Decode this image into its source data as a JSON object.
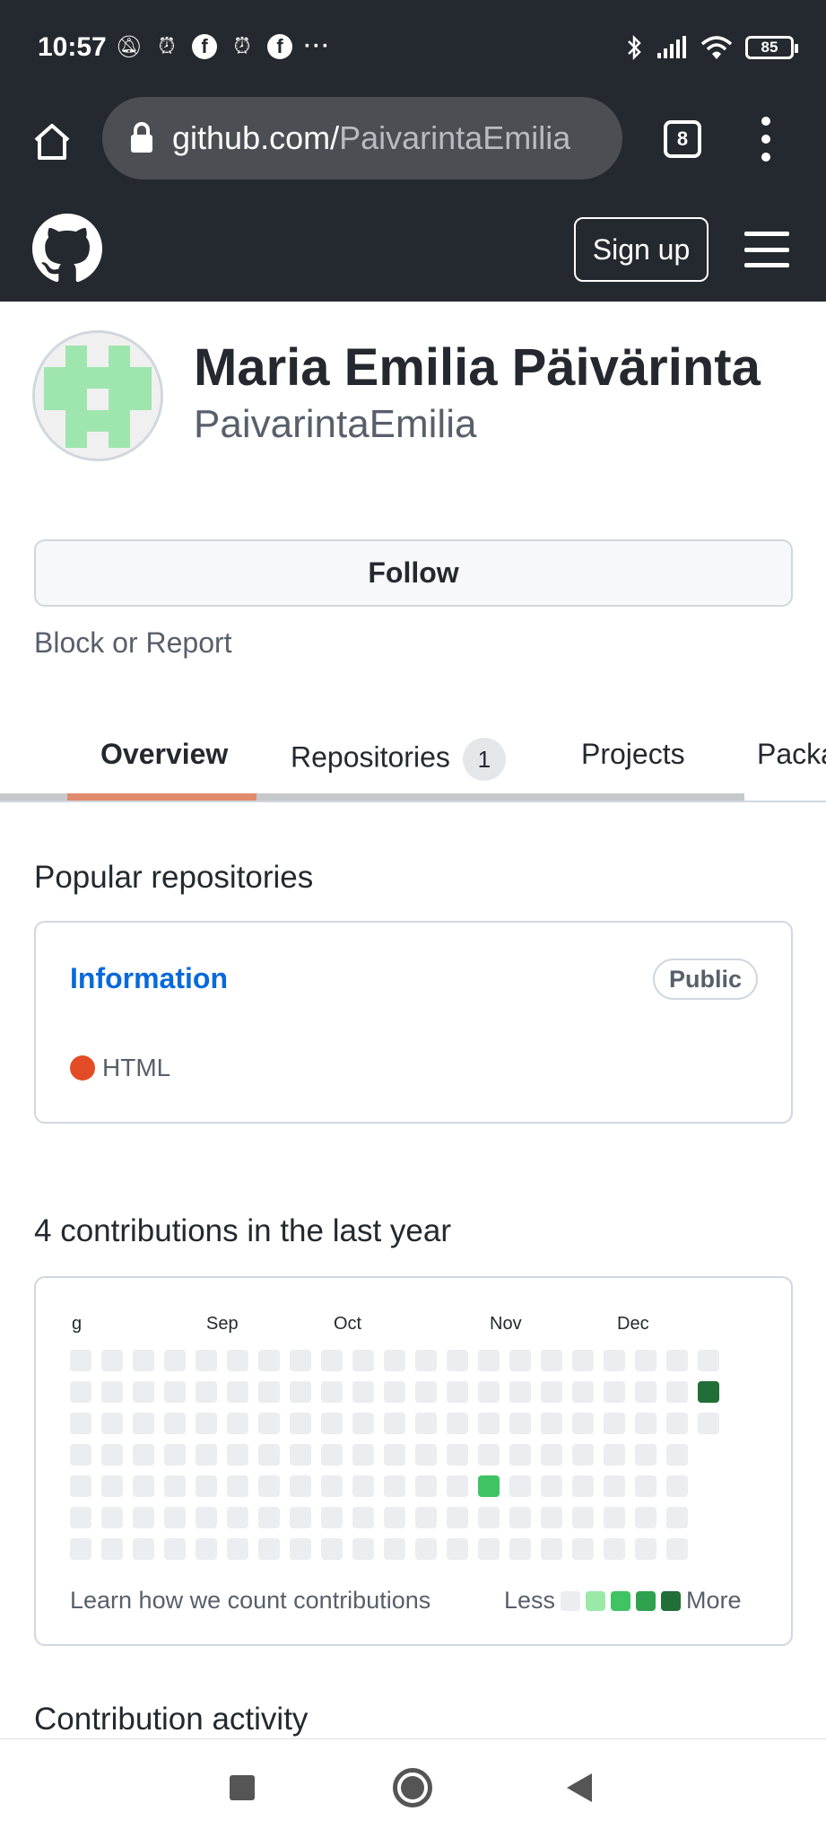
{
  "status_bar": {
    "time": "10:57",
    "battery": "85"
  },
  "browser": {
    "url_domain": "github.com/",
    "url_path": "PaivarintaEmilia",
    "tab_count": "8"
  },
  "header": {
    "signup_label": "Sign up"
  },
  "profile": {
    "name": "Maria Emilia Päivärinta",
    "login": "PaivarintaEmilia",
    "follow_label": "Follow",
    "block_label": "Block or Report"
  },
  "tabs": [
    {
      "label": "Overview",
      "active": true
    },
    {
      "label": "Repositories",
      "count": "1"
    },
    {
      "label": "Projects"
    },
    {
      "label": "Packa"
    }
  ],
  "popular": {
    "title": "Popular repositories",
    "repos": [
      {
        "name": "Information",
        "visibility": "Public",
        "language": "HTML",
        "language_color": "#e34c26"
      }
    ]
  },
  "contributions": {
    "title": "4 contributions in the last year",
    "months": [
      "g",
      "Sep",
      "Oct",
      "Nov",
      "Dec"
    ],
    "legend_link": "Learn how we count contributions",
    "legend_less": "Less",
    "legend_more": "More",
    "level_colors": [
      "#ebedf0",
      "#9be9a8",
      "#40c463",
      "#30a14e",
      "#216e39"
    ]
  },
  "activity": {
    "title": "Contribution activity"
  }
}
